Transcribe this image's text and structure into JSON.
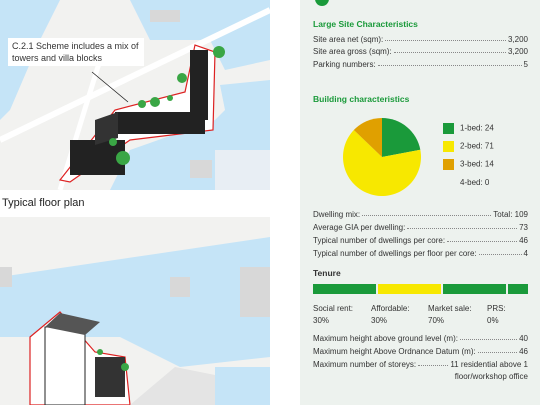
{
  "left": {
    "callout": "C.2.1 Scheme includes a mix of towers and villa blocks",
    "caption": "Typical floor plan"
  },
  "colors": {
    "green": "#1a9a3a",
    "yellow": "#f7e800",
    "orange": "#e0a000",
    "water": "#c5e4f7",
    "land": "#f2f2f0"
  },
  "site": {
    "title": "Large Site Characteristics",
    "rows": [
      {
        "label": "Site area net (sqm):",
        "value": "3,200"
      },
      {
        "label": "Site area gross (sqm):",
        "value": "3,200"
      },
      {
        "label": "Parking numbers:",
        "value": "5"
      }
    ]
  },
  "building": {
    "title": "Building characteristics",
    "legend": [
      {
        "label": "1-bed: 24",
        "color": "#1a9a3a"
      },
      {
        "label": "2-bed: 71",
        "color": "#f7e800"
      },
      {
        "label": "3-bed: 14",
        "color": "#e0a000"
      },
      {
        "label": "4-bed: 0",
        "color": ""
      }
    ]
  },
  "chart_data": {
    "type": "pie",
    "categories": [
      "1-bed",
      "2-bed",
      "3-bed",
      "4-bed"
    ],
    "values": [
      24,
      71,
      14,
      0
    ],
    "colors": [
      "#1a9a3a",
      "#f7e800",
      "#e0a000",
      "#ffffff"
    ]
  },
  "dwelling": {
    "mix_label": "Dwelling mix:",
    "mix_value": "Total: 109",
    "rows": [
      {
        "label": "Average GIA per dwelling:",
        "value": "73"
      },
      {
        "label": "Typical number of dwellings per core:",
        "value": "46"
      },
      {
        "label": "Typical number of dwellings per floor per core:",
        "value": "4"
      }
    ]
  },
  "tenure": {
    "title": "Tenure",
    "items": [
      {
        "label": "Social rent:",
        "value": "30%",
        "share": 0.3,
        "color": "#1a9a3a"
      },
      {
        "label": "Affordable:",
        "value": "30%",
        "share": 0.3,
        "color": "#f7e800"
      },
      {
        "label": "Market sale:",
        "value": "70%",
        "share": 0.3,
        "color": "#1a9a3a"
      },
      {
        "label": "PRS:",
        "value": "0%",
        "share": 0.1,
        "color": "#1a9a3a"
      }
    ]
  },
  "heights": {
    "rows": [
      {
        "label": "Maximum height above ground level (m):",
        "value": "40"
      },
      {
        "label": "Maximum height Above Ordnance Datum (m):",
        "value": "46"
      },
      {
        "label": "Maximum number of storeys:",
        "value": "11 residential above 1"
      }
    ],
    "storeys_line2": "floor/workshop office"
  }
}
